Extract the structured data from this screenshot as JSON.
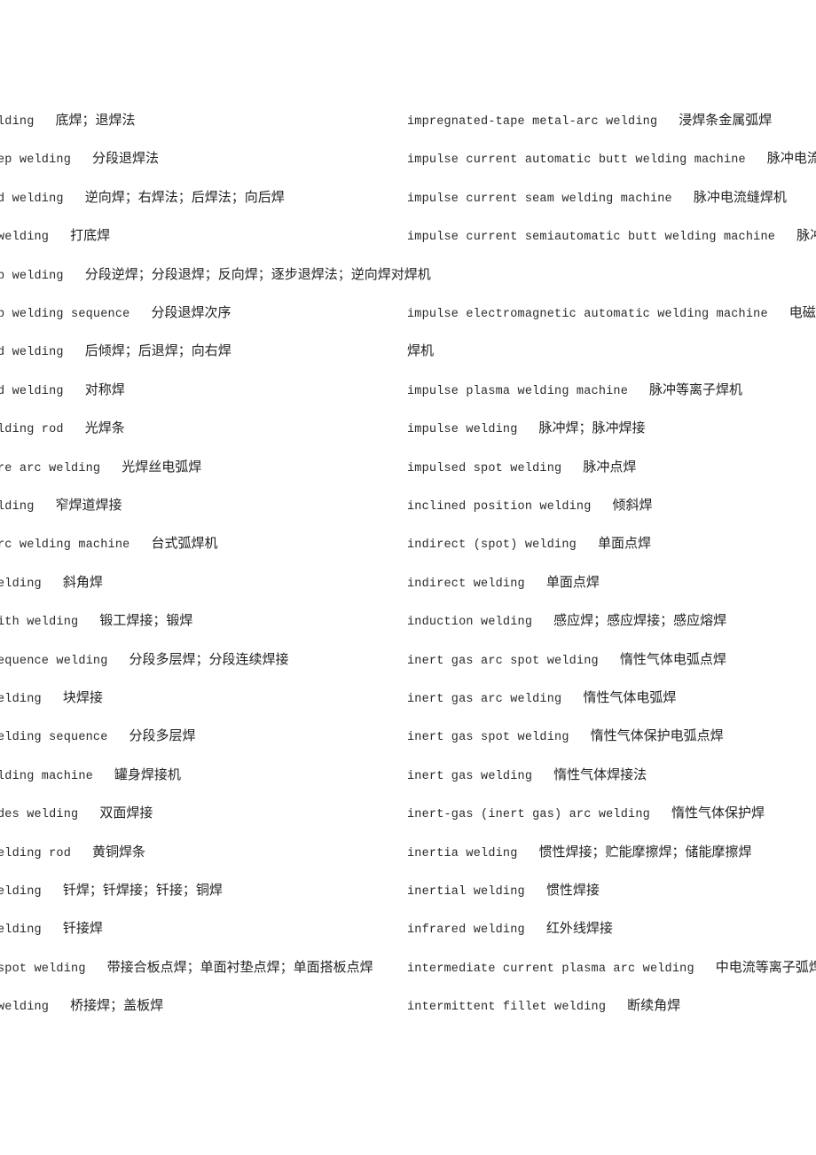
{
  "document": {
    "left_column": [
      {
        "term": "lding",
        "translation": "底焊；退焊法"
      },
      {
        "term": "ep welding",
        "translation": "分段退焊法"
      },
      {
        "term": "d welding",
        "translation": "逆向焊；右焊法；后焊法；向后焊"
      },
      {
        "term": " welding",
        "translation": "打底焊"
      },
      {
        "term": "p welding",
        "translation": "分段逆焊；分段退焊；反向焊；逐步退焊法；逆向焊对焊机"
      },
      {
        "term": "p welding sequence",
        "translation": "分段退焊次序"
      },
      {
        "term": "d welding",
        "translation": "后倾焊；后退焊；向右焊"
      },
      {
        "term": "d welding",
        "translation": "对称焊"
      },
      {
        "term": "lding rod",
        "translation": "光焊条"
      },
      {
        "term": "re arc welding",
        "translation": "光焊丝电弧焊"
      },
      {
        "term": "lding",
        "translation": "窄焊道焊接"
      },
      {
        "term": "rc welding machine",
        "translation": "台式弧焊机"
      },
      {
        "term": "elding",
        "translation": "斜角焊"
      },
      {
        "term": "ith welding",
        "translation": "锻工焊接；锻焊"
      },
      {
        "term": "equence welding",
        "translation": "分段多层焊；分段连续焊接"
      },
      {
        "term": "elding",
        "translation": "块焊接"
      },
      {
        "term": "elding sequence",
        "translation": "分段多层焊"
      },
      {
        "term": "lding machine",
        "translation": "罐身焊接机"
      },
      {
        "term": "des welding",
        "translation": "双面焊接"
      },
      {
        "term": "elding rod",
        "translation": "黄铜焊条"
      },
      {
        "term": "elding",
        "translation": "钎焊；钎焊接；钎接；铜焊"
      },
      {
        "term": "elding",
        "translation": "钎接焊"
      },
      {
        "term": "spot welding",
        "translation": "带接合板点焊；单面衬垫点焊；单面搭板点焊"
      },
      {
        "term": "welding",
        "translation": "桥接焊；盖板焊"
      }
    ],
    "right_column": [
      {
        "term": "impregnated-tape metal-arc welding",
        "translation": "浸焊条金属弧焊"
      },
      {
        "term": "impulse current automatic butt welding machine",
        "translation": "脉冲电流自动"
      },
      {
        "term": "impulse current seam welding machine",
        "translation": "脉冲电流缝焊机"
      },
      {
        "term": "impulse current semiautomatic butt welding machine",
        "translation": "脉冲电流"
      },
      {
        "term": "",
        "translation": ""
      },
      {
        "term": "impulse electromagnetic automatic welding machine",
        "translation": "电磁脉"
      },
      {
        "term": "",
        "translation": "焊机"
      },
      {
        "term": "impulse plasma welding machine",
        "translation": "脉冲等离子焊机"
      },
      {
        "term": "impulse welding",
        "translation": "脉冲焊；脉冲焊接"
      },
      {
        "term": "impulsed spot welding",
        "translation": "脉冲点焊"
      },
      {
        "term": "inclined position welding",
        "translation": "倾斜焊"
      },
      {
        "term": "indirect (spot) welding",
        "translation": "单面点焊"
      },
      {
        "term": "indirect welding",
        "translation": "单面点焊"
      },
      {
        "term": "induction welding",
        "translation": "感应焊；感应焊接；感应熔焊"
      },
      {
        "term": "inert gas arc spot welding",
        "translation": "惰性气体电弧点焊"
      },
      {
        "term": "inert gas arc welding",
        "translation": "惰性气体电弧焊"
      },
      {
        "term": "inert gas spot welding",
        "translation": "惰性气体保护电弧点焊"
      },
      {
        "term": "inert gas welding",
        "translation": "惰性气体焊接法"
      },
      {
        "term": "inert-gas (inert gas) arc welding",
        "translation": "惰性气体保护焊"
      },
      {
        "term": "inertia welding",
        "translation": "惯性焊接；贮能摩擦焊；储能摩擦焊"
      },
      {
        "term": "inertial welding",
        "translation": "惯性焊接"
      },
      {
        "term": "infrared welding",
        "translation": "红外线焊接"
      },
      {
        "term": "intermediate current plasma arc welding",
        "translation": "中电流等离子弧焊"
      },
      {
        "term": "intermittent fillet welding",
        "translation": "断续角焊"
      }
    ]
  }
}
